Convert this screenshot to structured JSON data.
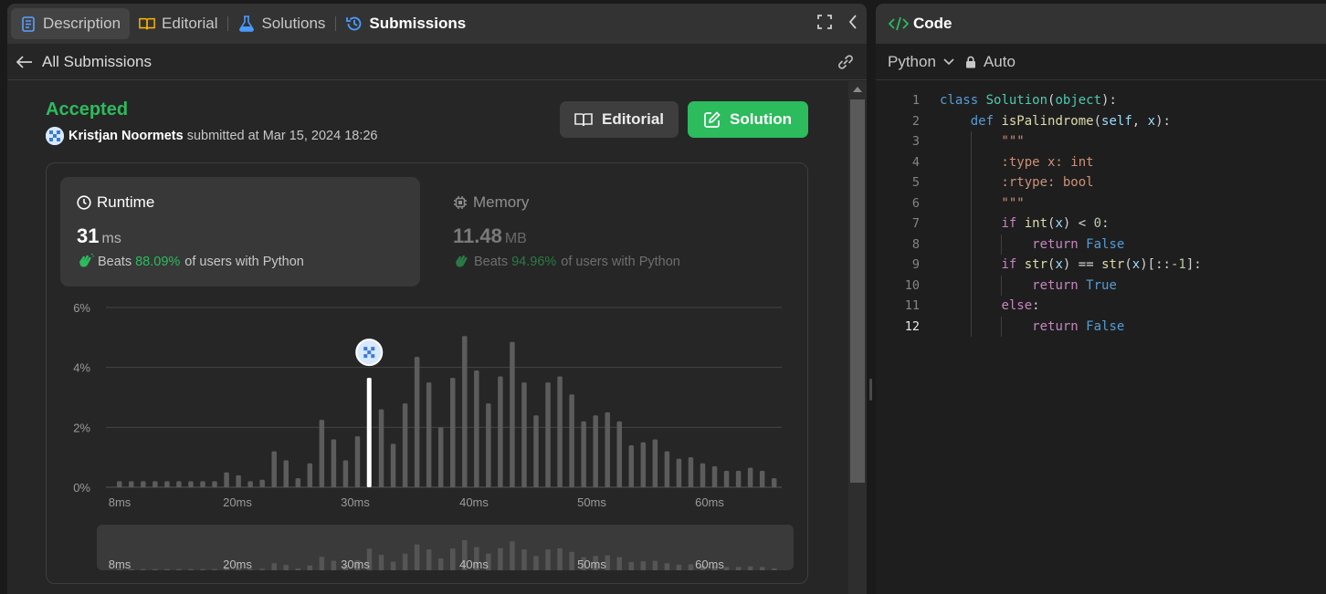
{
  "tabs": [
    {
      "label": "Description",
      "icon": "description-icon",
      "active": true
    },
    {
      "label": "Editorial",
      "icon": "book-icon"
    },
    {
      "label": "Solutions",
      "icon": "flask-icon"
    },
    {
      "label": "Submissions",
      "icon": "history-icon",
      "selected": true
    }
  ],
  "subheader": {
    "back_label": "All Submissions"
  },
  "submission": {
    "status": "Accepted",
    "user": "Kristjan Noormets",
    "submitted_text": "submitted at Mar 15, 2024 18:26",
    "editorial_button": "Editorial",
    "solution_button": "Solution"
  },
  "runtime": {
    "title": "Runtime",
    "value": "31",
    "unit": "ms",
    "beats_prefix": "Beats",
    "beats_pct": "88.09%",
    "beats_suffix": "of users with Python"
  },
  "memory": {
    "title": "Memory",
    "value": "11.48",
    "unit": "MB",
    "beats_prefix": "Beats",
    "beats_pct": "94.96%",
    "beats_suffix": "of users with Python"
  },
  "chart_data": {
    "type": "bar",
    "y_ticks": [
      "6%",
      "4%",
      "2%",
      "0%"
    ],
    "ylim": [
      0,
      6
    ],
    "x_ticks": [
      "8ms",
      "20ms",
      "30ms",
      "40ms",
      "50ms",
      "60ms"
    ],
    "values": [
      0.2,
      0.2,
      0.2,
      0.2,
      0.2,
      0.2,
      0.2,
      0.2,
      0.2,
      0.5,
      0.4,
      0.2,
      0.25,
      1.2,
      0.9,
      0.3,
      0.8,
      2.25,
      1.6,
      0.9,
      1.7,
      3.65,
      2.6,
      1.45,
      2.8,
      4.35,
      3.5,
      2.0,
      3.65,
      5.05,
      3.9,
      2.8,
      3.7,
      4.85,
      3.5,
      2.4,
      3.5,
      3.7,
      3.1,
      2.2,
      2.4,
      2.5,
      2.2,
      1.4,
      1.5,
      1.6,
      1.2,
      0.95,
      1.0,
      0.8,
      0.7,
      0.55,
      0.55,
      0.65,
      0.55,
      0.3
    ],
    "highlight_index": 21,
    "highlight_color": "#ffffff",
    "bar_color": "#5c5c5c",
    "grid": true
  },
  "editor": {
    "title": "Code",
    "language": "Python",
    "mode": "Auto",
    "lines": [
      "class Solution(object):",
      "    def isPalindrome(self, x):",
      "        \"\"\"",
      "        :type x: int",
      "        :rtype: bool",
      "        \"\"\"",
      "        if int(x) < 0:",
      "            return False",
      "        if str(x) == str(x)[::-1]:",
      "            return True",
      "        else:",
      "            return False"
    ],
    "line_numbers": [
      "1",
      "2",
      "3",
      "4",
      "5",
      "6",
      "7",
      "8",
      "9",
      "10",
      "11",
      "12"
    ],
    "current_line": 12
  }
}
